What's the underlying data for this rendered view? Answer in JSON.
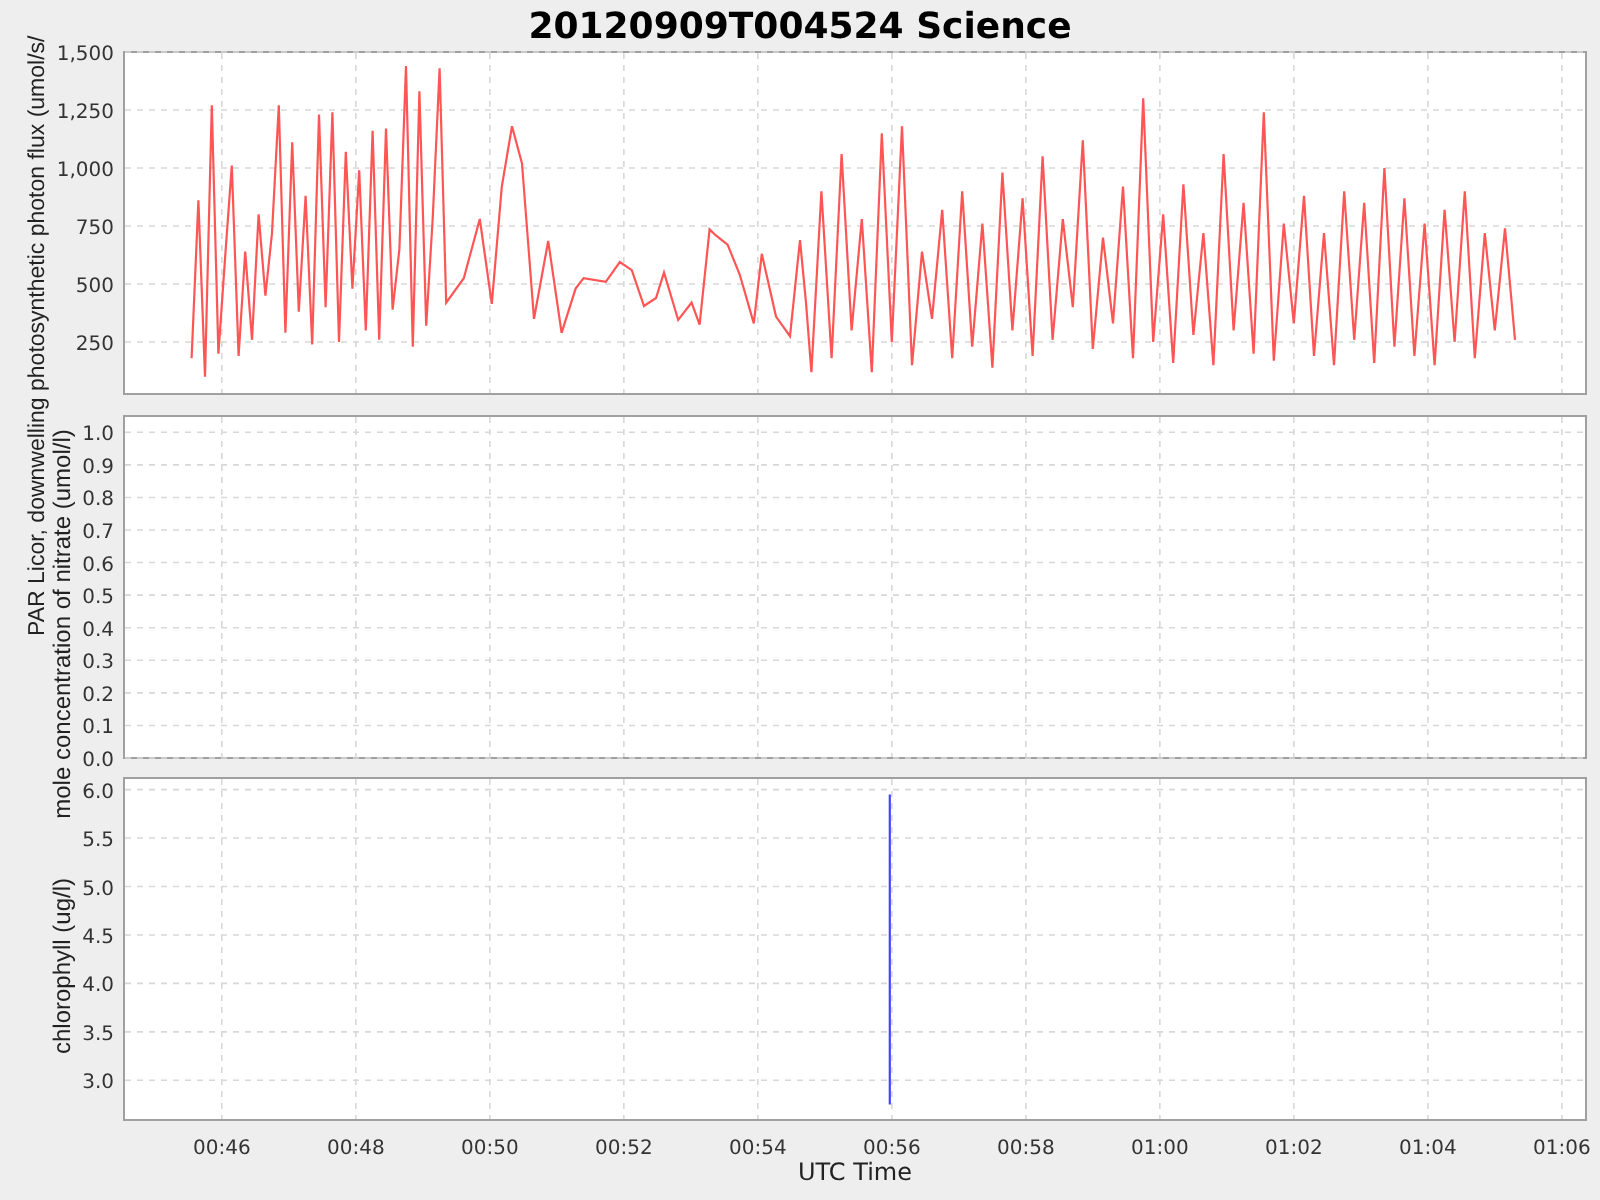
{
  "title": "20120909T004524 Science",
  "charts": [
    {
      "chart_data": {
        "type": "line",
        "ylabel": "PAR Licor, downwelling photosynthetic photon flux (umol/s/",
        "xlim": [
          44.54,
          66.36
        ],
        "ylim": [
          26,
          1500
        ],
        "grid": true,
        "yticks": [
          {
            "value": 250,
            "label": "250"
          },
          {
            "value": 500,
            "label": "500"
          },
          {
            "value": 750,
            "label": "750"
          },
          {
            "value": 1000,
            "label": "1,000"
          },
          {
            "value": 1250,
            "label": "1,250"
          },
          {
            "value": 1500,
            "label": "1,500"
          }
        ],
        "x": [
          45.55,
          45.65,
          45.75,
          45.85,
          45.95,
          46.05,
          46.15,
          46.25,
          46.35,
          46.45,
          46.55,
          46.65,
          46.75,
          46.85,
          46.95,
          47.05,
          47.15,
          47.25,
          47.35,
          47.45,
          47.55,
          47.65,
          47.75,
          47.85,
          47.95,
          48.05,
          48.15,
          48.25,
          48.35,
          48.45,
          48.55,
          48.65,
          48.75,
          48.85,
          48.95,
          49.05,
          49.15,
          49.25,
          49.35,
          49.61,
          49.85,
          50.03,
          50.18,
          50.33,
          50.48,
          50.66,
          50.87,
          51.07,
          51.28,
          51.4,
          51.73,
          51.94,
          52.12,
          52.3,
          52.48,
          52.6,
          52.81,
          53.01,
          53.13,
          53.28,
          53.37,
          53.55,
          53.73,
          53.94,
          54.06,
          54.27,
          54.48,
          54.63,
          54.72,
          54.8,
          54.95,
          55.1,
          55.25,
          55.4,
          55.55,
          55.7,
          55.85,
          56,
          56.15,
          56.3,
          56.45,
          56.6,
          56.75,
          56.9,
          57.05,
          57.2,
          57.35,
          57.5,
          57.65,
          57.8,
          57.95,
          58.1,
          58.25,
          58.4,
          58.55,
          58.7,
          58.85,
          59,
          59.15,
          59.3,
          59.45,
          59.6,
          59.75,
          59.9,
          60.05,
          60.2,
          60.35,
          60.5,
          60.65,
          60.8,
          60.95,
          61.1,
          61.25,
          61.4,
          61.55,
          61.7,
          61.85,
          62,
          62.15,
          62.3,
          62.45,
          62.6,
          62.75,
          62.9,
          63.05,
          63.2,
          63.35,
          63.5,
          63.65,
          63.8,
          63.95,
          64.1,
          64.25,
          64.4,
          64.55,
          64.7,
          64.85,
          65,
          65.15,
          65.3
        ],
        "series": [
          {
            "color": "#ff5555",
            "values": [
              180,
              860,
              100,
              1270,
              200,
              620,
              1010,
              190,
              640,
              260,
              800,
              450,
              720,
              1270,
              290,
              1110,
              380,
              880,
              240,
              1230,
              400,
              1240,
              250,
              1070,
              480,
              990,
              300,
              1160,
              260,
              1170,
              390,
              650,
              1440,
              230,
              1330,
              320,
              790,
              1430,
              420,
              525,
              780,
              415,
              920,
              1180,
              1020,
              350,
              685,
              290,
              480,
              525,
              510,
              595,
              560,
              405,
              440,
              550,
              345,
              420,
              325,
              735,
              710,
              670,
              540,
              330,
              630,
              360,
              275,
              690,
              420,
              120,
              900,
              180,
              1060,
              300,
              780,
              120,
              1150,
              250,
              1180,
              150,
              640,
              350,
              820,
              180,
              900,
              230,
              760,
              140,
              980,
              300,
              870,
              190,
              1050,
              260,
              780,
              400,
              1120,
              220,
              700,
              330,
              920,
              180,
              1300,
              250,
              800,
              160,
              930,
              280,
              720,
              150,
              1060,
              300,
              850,
              200,
              1240,
              170,
              760,
              330,
              880,
              190,
              720,
              150,
              900,
              260,
              850,
              160,
              1000,
              230,
              870,
              190,
              760,
              150,
              820,
              250,
              900,
              180,
              720,
              300,
              740,
              260
            ]
          }
        ]
      }
    },
    {
      "chart_data": {
        "type": "line",
        "ylabel": "mole concentration of nitrate (umol/l)",
        "xlim": [
          44.54,
          66.36
        ],
        "ylim": [
          0,
          1.05
        ],
        "grid": true,
        "yticks": [
          {
            "value": 0,
            "label": "0.0"
          },
          {
            "value": 0.1,
            "label": "0.1"
          },
          {
            "value": 0.2,
            "label": "0.2"
          },
          {
            "value": 0.3,
            "label": "0.3"
          },
          {
            "value": 0.4,
            "label": "0.4"
          },
          {
            "value": 0.5,
            "label": "0.5"
          },
          {
            "value": 0.6,
            "label": "0.6"
          },
          {
            "value": 0.7,
            "label": "0.7"
          },
          {
            "value": 0.8,
            "label": "0.8"
          },
          {
            "value": 0.9,
            "label": "0.9"
          },
          {
            "value": 1.0,
            "label": "1.0"
          }
        ]
      }
    },
    {
      "chart_data": {
        "type": "line",
        "ylabel": "chlorophyll (ug/l)",
        "xlabel": "UTC Time",
        "xlim": [
          44.54,
          66.36
        ],
        "ylim": [
          2.59,
          6.12
        ],
        "grid": true,
        "xticks": [
          {
            "value": 46,
            "label": "00:46"
          },
          {
            "value": 48,
            "label": "00:48"
          },
          {
            "value": 50,
            "label": "00:50"
          },
          {
            "value": 52,
            "label": "00:52"
          },
          {
            "value": 54,
            "label": "00:54"
          },
          {
            "value": 56,
            "label": "00:56"
          },
          {
            "value": 58,
            "label": "00:58"
          },
          {
            "value": 60,
            "label": "01:00"
          },
          {
            "value": 62,
            "label": "01:02"
          },
          {
            "value": 64,
            "label": "01:04"
          },
          {
            "value": 66,
            "label": "01:06"
          }
        ],
        "yticks": [
          {
            "value": 3,
            "label": "3.0"
          },
          {
            "value": 3.5,
            "label": "3.5"
          },
          {
            "value": 4,
            "label": "4.0"
          },
          {
            "value": 4.5,
            "label": "4.5"
          },
          {
            "value": 5,
            "label": "5.0"
          },
          {
            "value": 5.5,
            "label": "5.5"
          },
          {
            "value": 6,
            "label": "6.0"
          }
        ],
        "x": [
          55.97,
          55.97
        ],
        "series": [
          {
            "color": "#4444ff",
            "values": [
              2.75,
              5.95
            ]
          }
        ]
      }
    }
  ]
}
